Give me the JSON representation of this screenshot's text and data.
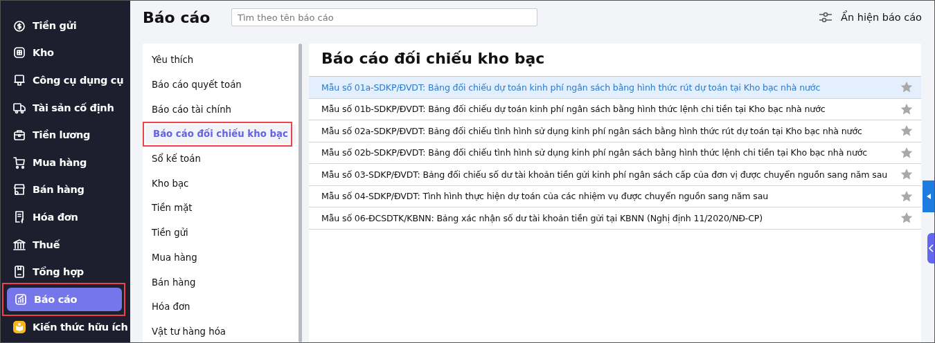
{
  "sidebar": {
    "items": [
      {
        "label": "Tiền gửi",
        "selected": false,
        "highlighted": false
      },
      {
        "label": "Kho",
        "selected": false,
        "highlighted": false
      },
      {
        "label": "Công cụ dụng cụ",
        "selected": false,
        "highlighted": false
      },
      {
        "label": "Tài sản cố định",
        "selected": false,
        "highlighted": false
      },
      {
        "label": "Tiền lương",
        "selected": false,
        "highlighted": false
      },
      {
        "label": "Mua hàng",
        "selected": false,
        "highlighted": false
      },
      {
        "label": "Bán hàng",
        "selected": false,
        "highlighted": false
      },
      {
        "label": "Hóa đơn",
        "selected": false,
        "highlighted": false
      },
      {
        "label": "Thuế",
        "selected": false,
        "highlighted": false
      },
      {
        "label": "Tổng hợp",
        "selected": false,
        "highlighted": false
      },
      {
        "label": "Báo cáo",
        "selected": true,
        "highlighted": true
      },
      {
        "label": "Kiến thức hữu ích",
        "selected": false,
        "highlighted": false
      }
    ]
  },
  "header": {
    "title": "Báo cáo",
    "search": {
      "placeholder": "Tìm theo tên báo cáo"
    },
    "toggle_button": "Ẩn hiện báo cáo"
  },
  "categories": [
    {
      "label": "Yêu thích",
      "selected": false,
      "highlighted": false
    },
    {
      "label": "Báo cáo quyết toán",
      "selected": false,
      "highlighted": false
    },
    {
      "label": "Báo cáo tài chính",
      "selected": false,
      "highlighted": false
    },
    {
      "label": "Báo cáo đối chiếu kho bạc",
      "selected": true,
      "highlighted": true
    },
    {
      "label": "Sổ kế toán",
      "selected": false,
      "highlighted": false
    },
    {
      "label": "Kho bạc",
      "selected": false,
      "highlighted": false
    },
    {
      "label": "Tiền mặt",
      "selected": false,
      "highlighted": false
    },
    {
      "label": "Tiền gửi",
      "selected": false,
      "highlighted": false
    },
    {
      "label": "Mua hàng",
      "selected": false,
      "highlighted": false
    },
    {
      "label": "Bán hàng",
      "selected": false,
      "highlighted": false
    },
    {
      "label": "Hóa đơn",
      "selected": false,
      "highlighted": false
    },
    {
      "label": "Vật tư hàng hóa",
      "selected": false,
      "highlighted": false
    }
  ],
  "reports": {
    "title": "Báo cáo đối chiếu kho bạc",
    "rows": [
      {
        "label": "Mẫu số 01a-SDKP/ĐVDT: Bảng đối chiếu dự toán kinh phí ngân sách bằng hình thức rút dự toán tại Kho bạc nhà nước",
        "selected": true,
        "favorite": false
      },
      {
        "label": "Mẫu số 01b-SDKP/ĐVDT: Bảng đối chiếu dự toán kinh phí ngân sách bằng hình thức lệnh chi tiền tại Kho bạc nhà nước",
        "selected": false,
        "favorite": false
      },
      {
        "label": "Mẫu số 02a-SDKP/ĐVDT: Bảng đối chiếu tình hình sử dụng kinh phí ngân sách bằng hình thức rút dự toán tại Kho bạc nhà nước",
        "selected": false,
        "favorite": false
      },
      {
        "label": "Mẫu số 02b-SDKP/ĐVDT: Bảng đối chiếu tình hình sử dụng kinh phí ngân sách bằng hình thức lệnh chi tiền tại Kho bạc nhà nước",
        "selected": false,
        "favorite": false
      },
      {
        "label": "Mẫu số 03-SDKP/ĐVDT: Bảng đối chiếu số dư tài khoản tiền gửi kinh phí ngân sách cấp của đơn vị được chuyển nguồn sang năm sau",
        "selected": false,
        "favorite": false
      },
      {
        "label": "Mẫu số 04-SDKP/ĐVDT: Tình hình thực hiện dự toán của các nhiệm vụ được chuyển nguồn sang năm sau",
        "selected": false,
        "favorite": false
      },
      {
        "label": "Mẫu số 06-ĐCSDTK/KBNN: Bảng xác nhận số dư tài khoản tiền gửi tại KBNN (Nghị định 11/2020/NĐ-CP)",
        "selected": false,
        "favorite": false
      }
    ]
  }
}
